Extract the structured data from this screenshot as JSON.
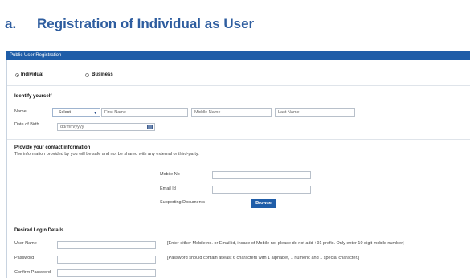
{
  "heading": {
    "number": "a.",
    "title": "Registration of Individual as User"
  },
  "panel": {
    "title": "Public User Registration"
  },
  "user_type": {
    "individual": "Individual",
    "business": "Business",
    "selected": "Individual"
  },
  "identify": {
    "title": "Identify yourself",
    "name_label": "Name",
    "salutation_value": "--Select--",
    "first_name_placeholder": "First Name",
    "middle_name_placeholder": "Middle Name",
    "last_name_placeholder": "Last Name",
    "dob_label": "Date of Birth",
    "dob_placeholder": "dd/mm/yyyy"
  },
  "contact": {
    "title": "Provide your contact information",
    "note": "The information provided by you will be safe and not be shared with any external or third-party.",
    "mobile_label": "Mobile No",
    "email_label": "Email Id",
    "docs_label": "Supporting Documents",
    "browse_label": "Browse"
  },
  "login": {
    "title": "Desired Login Details",
    "username_label": "User Name",
    "username_hint": "[Enter either Mobile no. or Email id, incase of Mobile no. please do not add +91 prefix. Only enter 10 digit mobile number]",
    "password_label": "Password",
    "password_hint": "[Password should contain atleast 6 characters with 1 alphabet, 1 numeric and 1 special character.]",
    "confirm_label": "Confirm Password"
  }
}
